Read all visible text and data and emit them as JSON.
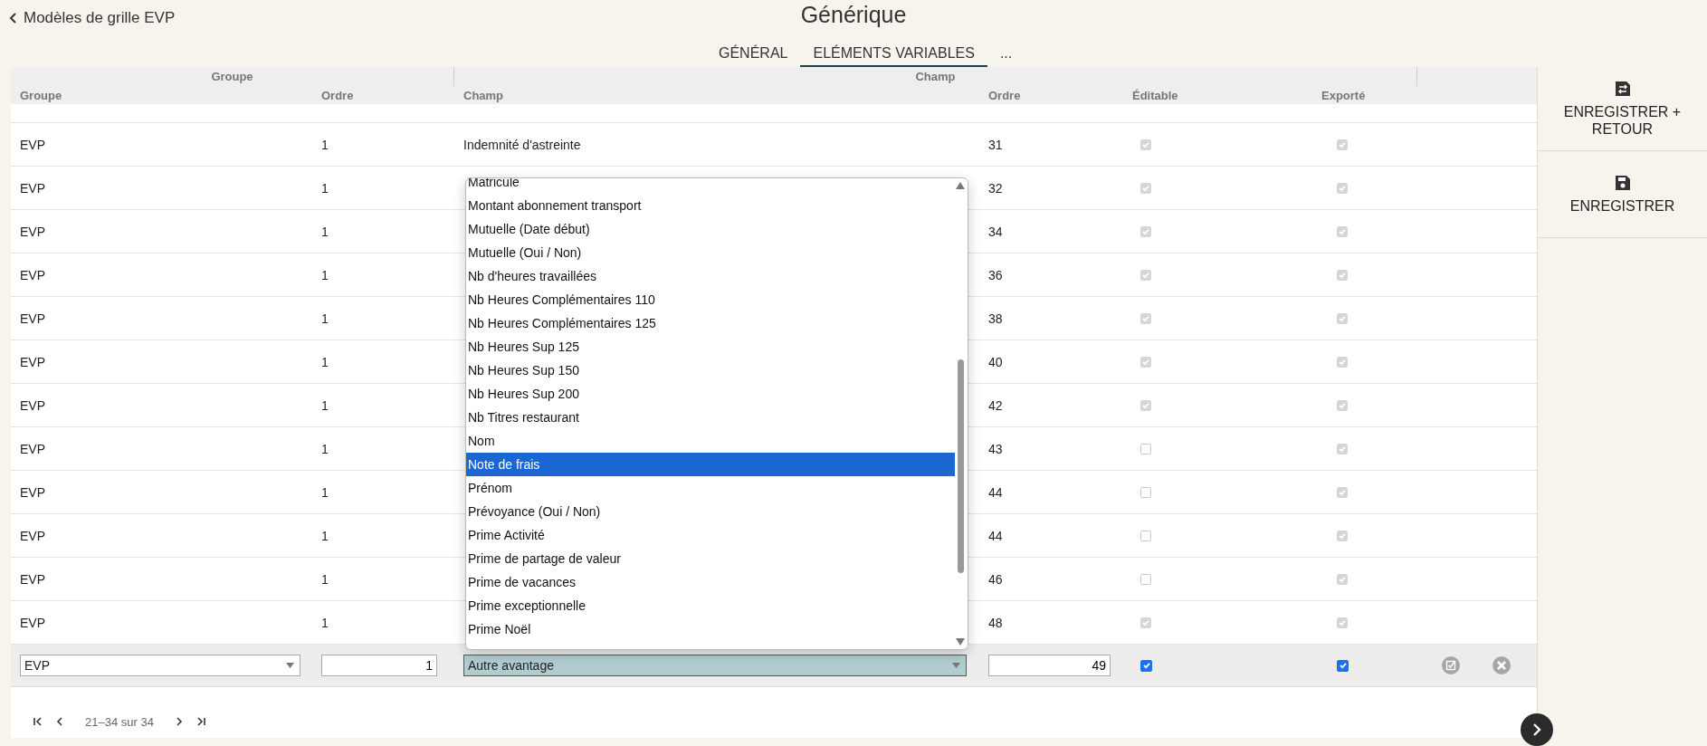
{
  "header": {
    "back_link": "Modèles de grille EVP",
    "title": "Générique"
  },
  "tabs": [
    {
      "label": "GÉNÉRAL",
      "selected": false
    },
    {
      "label": "ELÉMENTS VARIABLES",
      "selected": true
    },
    {
      "label": "...",
      "selected": false
    }
  ],
  "table": {
    "group_headers": [
      "Groupe",
      "Champ"
    ],
    "columns": [
      "Groupe",
      "Ordre",
      "Champ",
      "Ordre",
      "Éditable",
      "Exporté"
    ],
    "rows": [
      {
        "group": "EVP",
        "order": "1",
        "champ": "Indemnité d'astreinte",
        "champ_order": "31",
        "editable": true,
        "exported": true
      },
      {
        "group": "EVP",
        "order": "1",
        "champ_order": "32",
        "editable": true,
        "exported": true
      },
      {
        "group": "EVP",
        "order": "1",
        "champ_order": "34",
        "editable": true,
        "exported": true
      },
      {
        "group": "EVP",
        "order": "1",
        "champ_order": "36",
        "editable": true,
        "exported": true
      },
      {
        "group": "EVP",
        "order": "1",
        "champ_order": "38",
        "editable": true,
        "exported": true
      },
      {
        "group": "EVP",
        "order": "1",
        "champ_order": "40",
        "editable": true,
        "exported": true
      },
      {
        "group": "EVP",
        "order": "1",
        "champ_order": "42",
        "editable": true,
        "exported": true
      },
      {
        "group": "EVP",
        "order": "1",
        "champ_order": "43",
        "editable": false,
        "exported": true
      },
      {
        "group": "EVP",
        "order": "1",
        "champ_order": "44",
        "editable": false,
        "exported": true
      },
      {
        "group": "EVP",
        "order": "1",
        "champ_order": "44",
        "editable": false,
        "exported": true
      },
      {
        "group": "EVP",
        "order": "1",
        "champ_order": "46",
        "editable": false,
        "exported": true
      },
      {
        "group": "EVP",
        "order": "1",
        "champ_order": "48",
        "editable": true,
        "exported": true
      }
    ],
    "edit_row": {
      "group": "EVP",
      "order": "1",
      "champ": "Autre avantage",
      "champ_order": "49",
      "editable": true,
      "exported": true
    },
    "champ_dropdown": [
      {
        "label": "Matricule",
        "selected": false
      },
      {
        "label": "Montant abonnement transport",
        "selected": false
      },
      {
        "label": "Mutuelle (Date début)",
        "selected": false
      },
      {
        "label": "Mutuelle (Oui / Non)",
        "selected": false
      },
      {
        "label": "Nb d'heures travaillées",
        "selected": false
      },
      {
        "label": "Nb Heures Complémentaires 110",
        "selected": false
      },
      {
        "label": "Nb Heures Complémentaires 125",
        "selected": false
      },
      {
        "label": "Nb Heures Sup 125",
        "selected": false
      },
      {
        "label": "Nb Heures Sup 150",
        "selected": false
      },
      {
        "label": "Nb Heures Sup 200",
        "selected": false
      },
      {
        "label": "Nb Titres restaurant",
        "selected": false
      },
      {
        "label": "Nom",
        "selected": false
      },
      {
        "label": "Note de frais",
        "selected": true
      },
      {
        "label": "Prénom",
        "selected": false
      },
      {
        "label": "Prévoyance (Oui / Non)",
        "selected": false
      },
      {
        "label": "Prime Activité",
        "selected": false
      },
      {
        "label": "Prime de partage de valeur",
        "selected": false
      },
      {
        "label": "Prime de vacances",
        "selected": false
      },
      {
        "label": "Prime exceptionnelle",
        "selected": false
      },
      {
        "label": "Prime Noël",
        "selected": false
      }
    ],
    "pagination": "21–34 sur 34"
  },
  "actions": [
    {
      "kind": "save-return",
      "label": "ENREGISTRER + RETOUR"
    },
    {
      "kind": "save",
      "label": "ENREGISTRER"
    }
  ]
}
